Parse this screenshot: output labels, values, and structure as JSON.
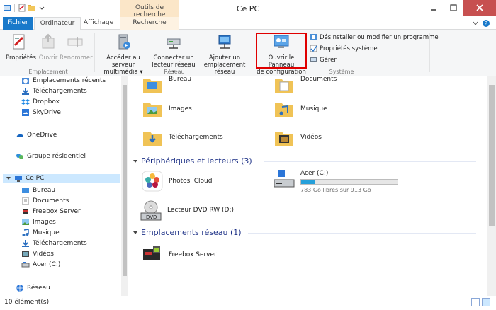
{
  "window": {
    "title": "Ce PC",
    "context_tab_header": "Outils de recherche"
  },
  "tabs": [
    {
      "label": "Fichier"
    },
    {
      "label": "Ordinateur"
    },
    {
      "label": "Affichage"
    },
    {
      "label": "Recherche"
    }
  ],
  "ribbon": {
    "emplacement": {
      "label": "Emplacement",
      "buttons": [
        {
          "label": "Propriétés"
        },
        {
          "label": "Ouvrir"
        },
        {
          "label": "Renommer"
        }
      ]
    },
    "reseau": {
      "label": "Réseau",
      "buttons": [
        {
          "line1": "Accéder au serveur",
          "line2": "multimédia ▾"
        },
        {
          "line1": "Connecter un",
          "line2": "lecteur réseau ▾"
        },
        {
          "line1": "Ajouter un",
          "line2": "emplacement réseau"
        }
      ]
    },
    "systeme": {
      "label": "Système",
      "big": {
        "line1": "Ouvrir le Panneau",
        "line2": "de configuration"
      },
      "small": [
        {
          "label": "Désinstaller ou modifier un programme"
        },
        {
          "label": "Propriétés système"
        },
        {
          "label": "Gérer"
        }
      ]
    }
  },
  "nav": [
    {
      "label": "Emplacements récents"
    },
    {
      "label": "Téléchargements"
    },
    {
      "label": "Dropbox"
    },
    {
      "label": "SkyDrive"
    },
    {
      "label": "OneDrive"
    },
    {
      "label": "Groupe résidentiel"
    },
    {
      "label": "Ce PC"
    },
    {
      "label": "Bureau"
    },
    {
      "label": "Documents"
    },
    {
      "label": "Freebox Server"
    },
    {
      "label": "Images"
    },
    {
      "label": "Musique"
    },
    {
      "label": "Téléchargements"
    },
    {
      "label": "Vidéos"
    },
    {
      "label": "Acer (C:)"
    },
    {
      "label": "Réseau"
    }
  ],
  "folders": [
    {
      "label": "Bureau"
    },
    {
      "label": "Documents"
    },
    {
      "label": "Images"
    },
    {
      "label": "Musique"
    },
    {
      "label": "Téléchargements"
    },
    {
      "label": "Vidéos"
    }
  ],
  "devices_section": {
    "label": "Périphériques et lecteurs (3)"
  },
  "devices": [
    {
      "label": "Photos iCloud"
    },
    {
      "label": "Acer (C:)",
      "sub": "783 Go libres sur 913 Go",
      "used_fraction": 0.142
    },
    {
      "label": "Lecteur DVD RW (D:)"
    }
  ],
  "network_section": {
    "label": "Emplacements réseau (1)"
  },
  "network": [
    {
      "label": "Freebox Server"
    }
  ],
  "status": {
    "count": "10 élément(s)"
  },
  "colors": {
    "accent": "#1979ca",
    "highlight": "#e00000",
    "section_text": "#1e3287",
    "drive_fill": "#26a0da"
  }
}
